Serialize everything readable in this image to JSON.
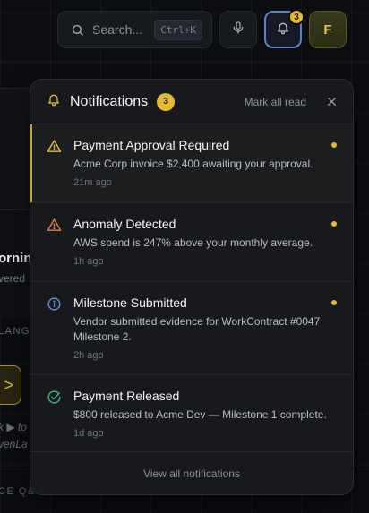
{
  "header": {
    "search": {
      "placeholder": "Search...",
      "shortcut": "Ctrl+K"
    },
    "notification_count": "3",
    "avatar_initial": "F"
  },
  "background": {
    "greeting_fragment": "orning",
    "subtitle_fragment": "vered",
    "section_fragment": "LANG",
    "hint_line1": "k ▶ to",
    "hint_line2": "venLa",
    "section2_fragment": "CE Q&",
    "right_fragment": "",
    "arrow": ">"
  },
  "notifications_panel": {
    "title": "Notifications",
    "count": "3",
    "mark_all_read": "Mark all read",
    "view_all": "View all notifications",
    "items": [
      {
        "title": "Payment Approval Required",
        "message": "Acme Corp invoice $2,400 awaiting your approval.",
        "time": "21m ago",
        "icon": "warning-triangle-icon",
        "icon_color": "#e7b931",
        "unread": true
      },
      {
        "title": "Anomaly Detected",
        "message": "AWS spend is 247% above your monthly average.",
        "time": "1h ago",
        "icon": "alert-triangle-icon",
        "icon_color": "#e07a4a",
        "unread": true
      },
      {
        "title": "Milestone Submitted",
        "message": "Vendor submitted evidence for WorkContract #0047 Milestone 2.",
        "time": "2h ago",
        "icon": "info-circle-icon",
        "icon_color": "#5b8fd6",
        "unread": true
      },
      {
        "title": "Payment Released",
        "message": "$800 released to Acme Dev — Milestone 1 complete.",
        "time": "1d ago",
        "icon": "check-circle-icon",
        "icon_color": "#3fb57a",
        "unread": false
      }
    ]
  },
  "colors": {
    "accent": "#e7b931",
    "focus_ring": "#5a83c9",
    "panel_bg": "#17191d"
  }
}
